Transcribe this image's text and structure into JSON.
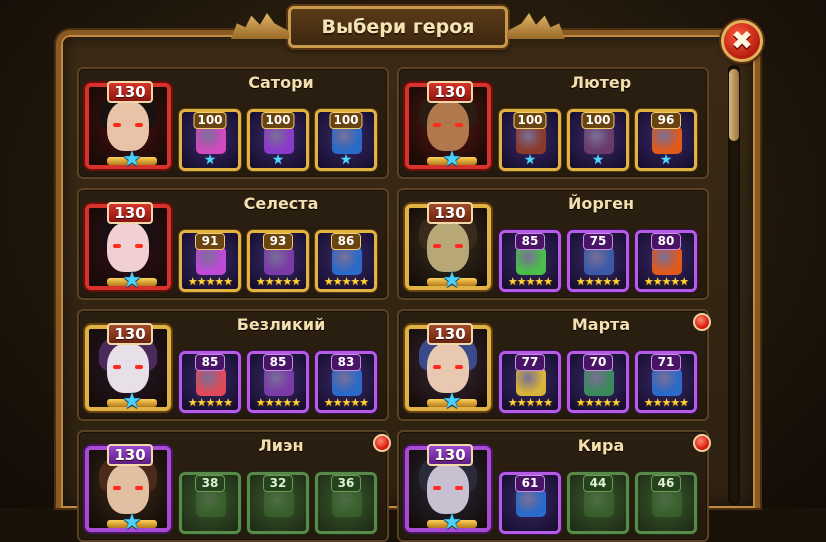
{
  "title": "Выбери героя",
  "close_label": "✖",
  "heroes": [
    {
      "name": "Сатори",
      "level": "130",
      "portrait_frame": "red",
      "skin": "#e8c3a8",
      "hair": "#1a1210",
      "bg": "#4a1010",
      "artifacts": [
        {
          "level": "100",
          "rarity": "gold",
          "stars": "★",
          "icon": "#d04ac0"
        },
        {
          "level": "100",
          "rarity": "gold",
          "stars": "★",
          "icon": "#8a3ac8"
        },
        {
          "level": "100",
          "rarity": "gold",
          "stars": "★",
          "icon": "#2a6ac8"
        }
      ],
      "notification": false
    },
    {
      "name": "Лютер",
      "level": "130",
      "portrait_frame": "red",
      "skin": "#b0784c",
      "hair": "#2a1c10",
      "bg": "#5a1410",
      "artifacts": [
        {
          "level": "100",
          "rarity": "gold",
          "stars": "★",
          "icon": "#8a3a2a"
        },
        {
          "level": "100",
          "rarity": "gold",
          "stars": "★",
          "icon": "#6a3a6a"
        },
        {
          "level": "96",
          "rarity": "gold",
          "stars": "★",
          "icon": "#e05a1c"
        }
      ],
      "notification": false
    },
    {
      "name": "Селеста",
      "level": "130",
      "portrait_frame": "red",
      "skin": "#f0d0d0",
      "hair": "#1a1014",
      "bg": "#3a0e1a",
      "artifacts": [
        {
          "level": "91",
          "rarity": "gold",
          "stars": "★★★★★",
          "icon": "#c04ad8"
        },
        {
          "level": "93",
          "rarity": "gold",
          "stars": "★★★★★",
          "icon": "#7a3aa8"
        },
        {
          "level": "86",
          "rarity": "gold",
          "stars": "★★★★★",
          "icon": "#2a6ac8"
        }
      ],
      "notification": false
    },
    {
      "name": "Йорген",
      "level": "130",
      "portrait_frame": "gold",
      "skin": "#b8a878",
      "hair": "#3a2a1c",
      "bg": "#3a3020",
      "artifacts": [
        {
          "level": "85",
          "rarity": "purple",
          "stars": "★★★★★",
          "icon": "#4ac04a"
        },
        {
          "level": "75",
          "rarity": "purple",
          "stars": "★★★★★",
          "icon": "#3a5aa8"
        },
        {
          "level": "80",
          "rarity": "purple",
          "stars": "★★★★★",
          "icon": "#e05a1c"
        }
      ],
      "notification": false
    },
    {
      "name": "Безликий",
      "level": "130",
      "portrait_frame": "gold",
      "skin": "#e8e0e8",
      "hair": "#4a2a5a",
      "bg": "#2a1a2a",
      "artifacts": [
        {
          "level": "85",
          "rarity": "purple",
          "stars": "★★★★★",
          "icon": "#e04a5a"
        },
        {
          "level": "85",
          "rarity": "purple",
          "stars": "★★★★★",
          "icon": "#7a3aa8"
        },
        {
          "level": "83",
          "rarity": "purple",
          "stars": "★★★★★",
          "icon": "#2a6ac8"
        }
      ],
      "notification": false
    },
    {
      "name": "Марта",
      "level": "130",
      "portrait_frame": "gold",
      "skin": "#e8c8b0",
      "hair": "#3a4a8a",
      "bg": "#3a2a3a",
      "artifacts": [
        {
          "level": "77",
          "rarity": "purple",
          "stars": "★★★★★",
          "icon": "#d8b43a"
        },
        {
          "level": "70",
          "rarity": "purple",
          "stars": "★★★★★",
          "icon": "#3a8a5a"
        },
        {
          "level": "71",
          "rarity": "purple",
          "stars": "★★★★★",
          "icon": "#2a6ac8"
        }
      ],
      "notification": true
    },
    {
      "name": "Лиэн",
      "level": "130",
      "portrait_frame": "purple",
      "skin": "#e0c0a0",
      "hair": "#4a2a1a",
      "bg": "#3a2a1a",
      "artifacts": [
        {
          "level": "38",
          "rarity": "green",
          "stars": "",
          "icon": "#4a8a3a"
        },
        {
          "level": "32",
          "rarity": "green",
          "stars": "",
          "icon": "#4a8a3a"
        },
        {
          "level": "36",
          "rarity": "green",
          "stars": "",
          "icon": "#4a8a3a"
        }
      ],
      "notification": true
    },
    {
      "name": "Кира",
      "level": "130",
      "portrait_frame": "purple",
      "skin": "#c8c0d0",
      "hair": "#2a2a3a",
      "bg": "#2a2a3a",
      "artifacts": [
        {
          "level": "61",
          "rarity": "purple",
          "stars": "",
          "icon": "#2a6ac8"
        },
        {
          "level": "44",
          "rarity": "green",
          "stars": "",
          "icon": "#4a8a3a"
        },
        {
          "level": "46",
          "rarity": "green",
          "stars": "",
          "icon": "#4a8a3a"
        }
      ],
      "notification": true
    }
  ]
}
